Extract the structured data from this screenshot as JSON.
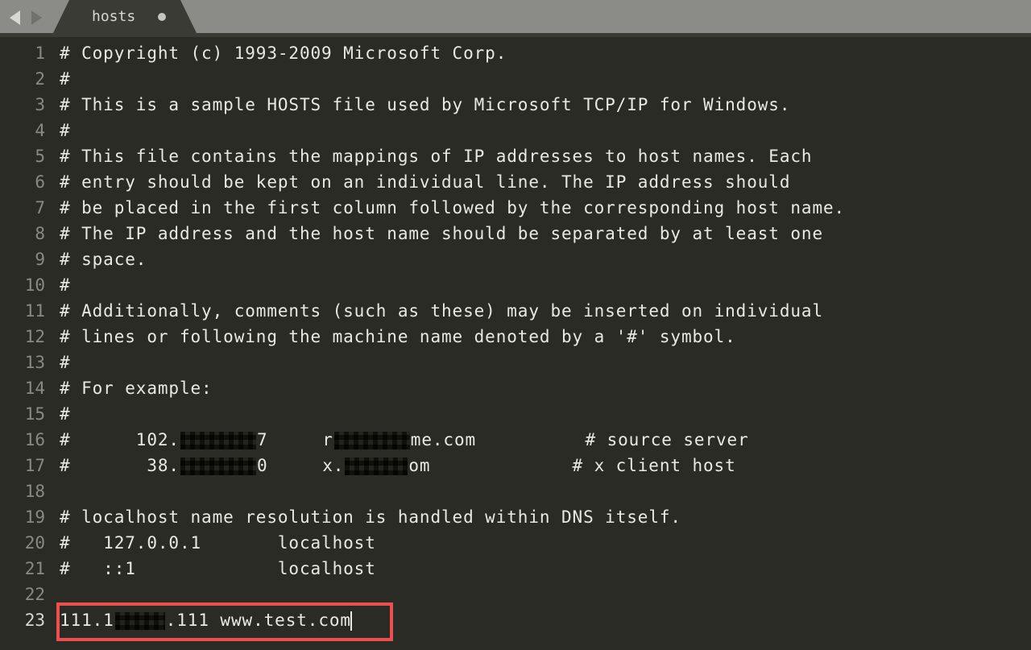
{
  "tab": {
    "title": "hosts",
    "dirty": true
  },
  "lines": {
    "l1": "# Copyright (c) 1993-2009 Microsoft Corp.",
    "l2": "#",
    "l3": "# This is a sample HOSTS file used by Microsoft TCP/IP for Windows.",
    "l4": "#",
    "l5": "# This file contains the mappings of IP addresses to host names. Each",
    "l6": "# entry should be kept on an individual line. The IP address should",
    "l7": "# be placed in the first column followed by the corresponding host name.",
    "l8": "# The IP address and the host name should be separated by at least one",
    "l9": "# space.",
    "l10": "#",
    "l11": "# Additionally, comments (such as these) may be inserted on individual",
    "l12": "# lines or following the machine name denoted by a '#' symbol.",
    "l13": "#",
    "l14": "# For example:",
    "l15": "#",
    "l16": {
      "pre": "#      102.",
      "after_ip": "7     r",
      "after_host": "me.com          # source server"
    },
    "l17": {
      "pre": "#       38.",
      "after_ip": "0     x.",
      "after_host": "om             # x client host"
    },
    "l18": "",
    "l19": "# localhost name resolution is handled within DNS itself.",
    "l20": "#   127.0.0.1       localhost",
    "l21": "#   ::1             localhost",
    "l22": "",
    "l23": {
      "pre": "111.1",
      "post": ".111 www.test.com"
    }
  },
  "line_numbers": {
    "n1": "1",
    "n2": "2",
    "n3": "3",
    "n4": "4",
    "n5": "5",
    "n6": "6",
    "n7": "7",
    "n8": "8",
    "n9": "9",
    "n10": "10",
    "n11": "11",
    "n12": "12",
    "n13": "13",
    "n14": "14",
    "n15": "15",
    "n16": "16",
    "n17": "17",
    "n18": "18",
    "n19": "19",
    "n20": "20",
    "n21": "21",
    "n22": "22",
    "n23": "23"
  }
}
